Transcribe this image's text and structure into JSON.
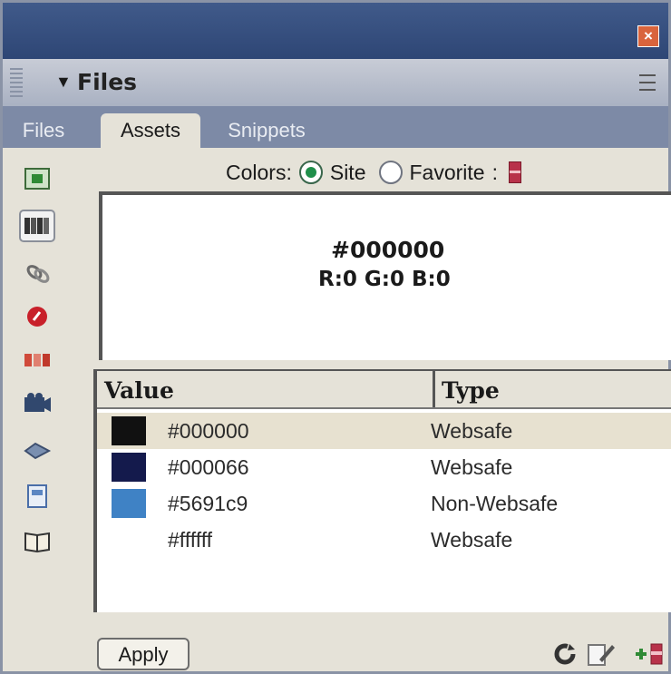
{
  "window": {
    "close_icon": "close-icon"
  },
  "panel": {
    "title": "Files",
    "collapse_icon": "triangle-down-icon",
    "options_icon": "panel-options-icon"
  },
  "tabs": [
    {
      "label": "Files",
      "active": false
    },
    {
      "label": "Assets",
      "active": true
    },
    {
      "label": "Snippets",
      "active": false
    }
  ],
  "categories": [
    {
      "icon": "images-icon",
      "selected": false
    },
    {
      "icon": "colors-icon",
      "selected": true
    },
    {
      "icon": "urls-icon",
      "selected": false
    },
    {
      "icon": "flash-icon",
      "selected": false
    },
    {
      "icon": "shockwave-icon",
      "selected": false
    },
    {
      "icon": "movies-icon",
      "selected": false
    },
    {
      "icon": "scripts-icon",
      "selected": false
    },
    {
      "icon": "templates-icon",
      "selected": false
    },
    {
      "icon": "library-icon",
      "selected": false
    }
  ],
  "colors_filter": {
    "label": "Colors:",
    "options": [
      {
        "label": "Site",
        "selected": true
      },
      {
        "label": "Favorite",
        "selected": false
      }
    ]
  },
  "preview": {
    "hex": "#000000",
    "rgb": "R:0 G:0 B:0"
  },
  "table": {
    "columns": [
      "Value",
      "Type"
    ],
    "rows": [
      {
        "swatch": "#000000",
        "value": "#000000",
        "type": "Websafe",
        "selected": true
      },
      {
        "swatch": "#000066",
        "value": "#000066",
        "type": "Websafe",
        "selected": false
      },
      {
        "swatch": "#5691c9",
        "value": "#5691c9",
        "type": "Non-Websafe",
        "selected": false
      },
      {
        "swatch": "#ffffff",
        "value": "#ffffff",
        "type": "Websafe",
        "selected": false
      }
    ]
  },
  "footer": {
    "apply_label": "Apply",
    "icons": [
      "refresh-icon",
      "edit-icon",
      "add-to-favorites-icon"
    ]
  },
  "colors": {
    "titlebar": "#2e4675",
    "tabbar": "#7d8aa6",
    "panel_bg": "#e5e2d8",
    "selected_row": "#e7e1d0"
  }
}
